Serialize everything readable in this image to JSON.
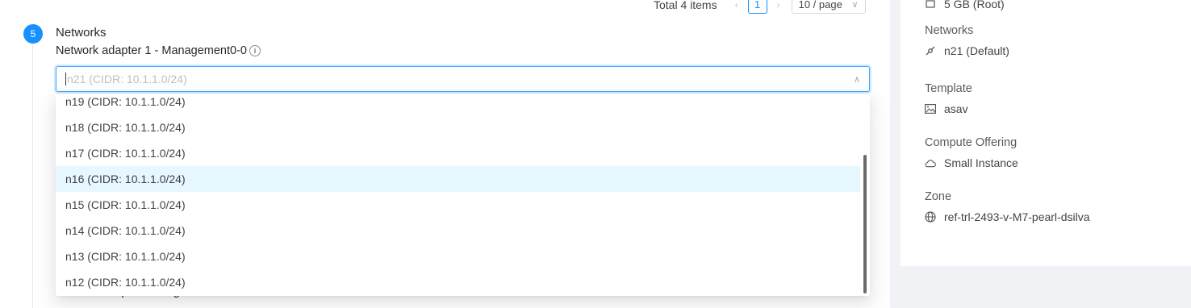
{
  "pagination": {
    "total_label": "Total 4 items",
    "prev_icon": "left-arrow-icon",
    "current_page": "1",
    "next_icon": "right-arrow-icon",
    "page_size": "10 / page"
  },
  "step": {
    "number": "5",
    "title": "Networks",
    "adapter_label": "Network adapter 1 - Management0-0",
    "next_adapter_label": "Network adapter 3 - GigabitEthernet0-0"
  },
  "select": {
    "placeholder": "n21 (CIDR: 10.1.1.0/24)",
    "options": [
      "n19 (CIDR: 10.1.1.0/24)",
      "n18 (CIDR: 10.1.1.0/24)",
      "n17 (CIDR: 10.1.1.0/24)",
      "n16 (CIDR: 10.1.1.0/24)",
      "n15 (CIDR: 10.1.1.0/24)",
      "n14 (CIDR: 10.1.1.0/24)",
      "n13 (CIDR: 10.1.1.0/24)",
      "n12 (CIDR: 10.1.1.0/24)"
    ],
    "highlighted_option": "n16 (CIDR: 10.1.1.0/24)"
  },
  "summary": {
    "disk_value": "5 GB (Root)",
    "networks": {
      "title": "Networks",
      "value": "n21 (Default)",
      "icon": "api-link-icon"
    },
    "template": {
      "title": "Template",
      "value": "asav",
      "icon": "picture-icon"
    },
    "compute_offering": {
      "title": "Compute Offering",
      "value": "Small Instance",
      "icon": "cloud-icon"
    },
    "zone": {
      "title": "Zone",
      "value": "ref-trl-2493-v-M7-pearl-dsilva",
      "icon": "globe-icon"
    }
  },
  "colors": {
    "primary": "#1890ff",
    "highlight": "#e6f7ff"
  }
}
